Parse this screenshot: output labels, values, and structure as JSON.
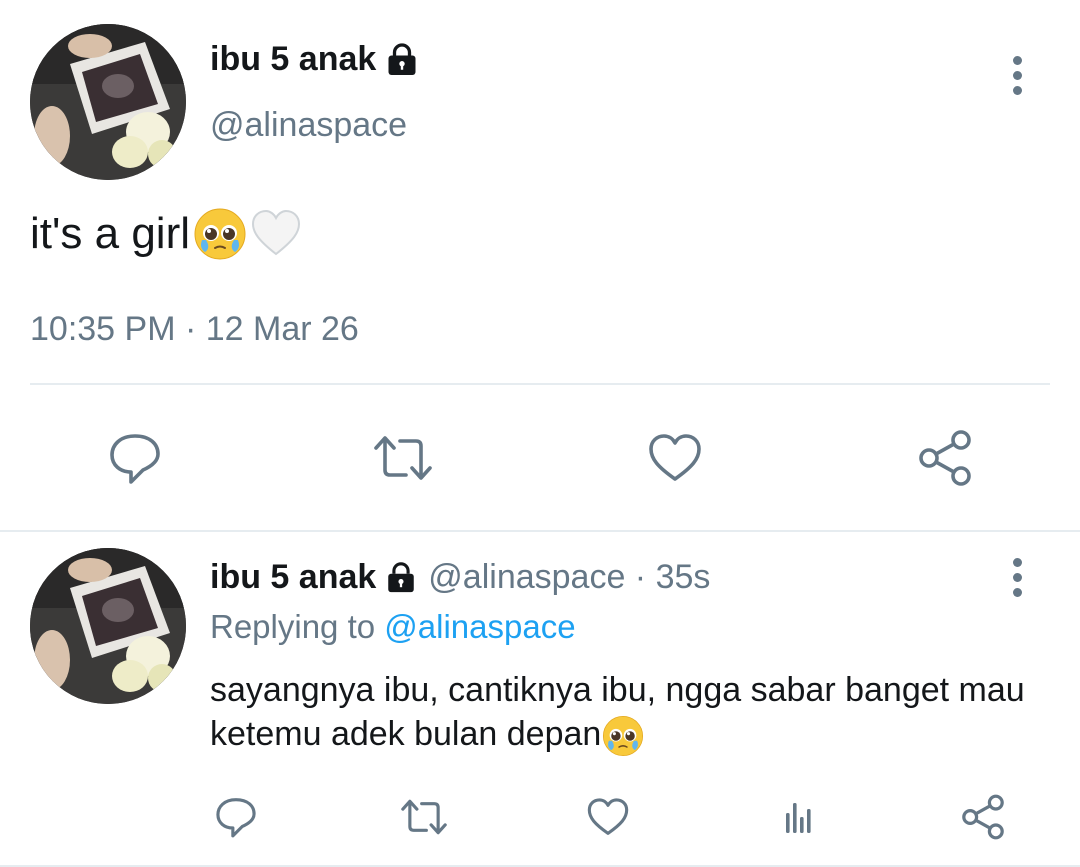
{
  "main_tweet": {
    "author_name": "ibu 5 anak",
    "handle": "@alinaspace",
    "text": "it's a girl",
    "timestamp": "10:35 PM · 12 Mar 26",
    "emojis": [
      "pleading-face-with-tears-emoji",
      "white-heart-emoji"
    ],
    "actions": [
      "reply-icon",
      "retweet-icon",
      "like-icon",
      "share-icon"
    ]
  },
  "reply_tweet": {
    "author_name": "ibu 5 anak",
    "handle_time": "@alinaspace · 35s",
    "replying_prefix": "Replying to",
    "replying_to": "@alinaspace",
    "text": "sayangnya ibu, cantiknya ibu, ngga sabar banget mau ketemu adek bulan depan",
    "actions": [
      "reply-icon",
      "retweet-icon",
      "like-icon",
      "analytics-icon",
      "share-icon"
    ]
  },
  "colors": {
    "text_primary": "#14171a",
    "text_secondary": "#657786",
    "link": "#1da1f2",
    "divider": "#e6ecf0"
  }
}
